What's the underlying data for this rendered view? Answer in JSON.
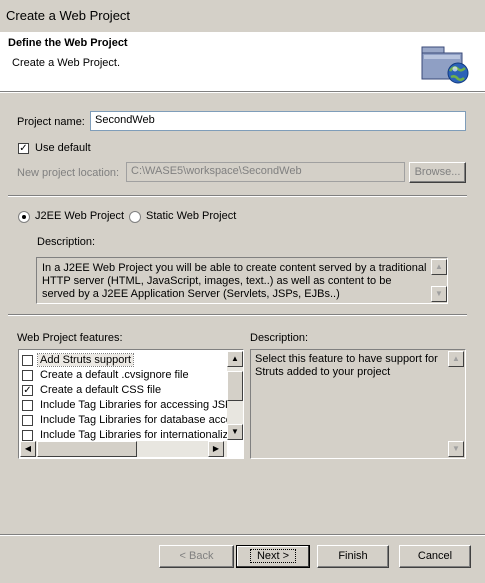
{
  "window": {
    "title": "Create a Web Project"
  },
  "header": {
    "title": "Define the Web Project",
    "subtitle": "Create a Web Project.",
    "icon": "web-project-globe-icon"
  },
  "form": {
    "project_name_label": "Project name:",
    "project_name_value": "SecondWeb",
    "use_default_label": "Use default",
    "use_default_checked": true,
    "location_label": "New project location:",
    "location_value": "C:\\WASE5\\workspace\\SecondWeb",
    "browse_label": "Browse..."
  },
  "project_type": {
    "options": [
      "J2EE Web Project",
      "Static Web Project"
    ],
    "selected": "J2EE Web Project",
    "description_label": "Description:",
    "description_text": "In a J2EE Web Project you will be able to create content served by a traditional HTTP server (HTML, JavaScript, images, text..) as well as content to be served by a J2EE Application Server (Servlets, JSPs, EJBs..)"
  },
  "features": {
    "label": "Web Project features:",
    "items": [
      {
        "label": "Add Struts support",
        "checked": false
      },
      {
        "label": "Create a default .cvsignore file",
        "checked": false
      },
      {
        "label": "Create a default CSS file",
        "checked": true
      },
      {
        "label": "Include Tag Libraries for accessing JSP objects",
        "checked": false
      },
      {
        "label": "Include Tag Libraries for database access",
        "checked": false
      },
      {
        "label": "Include Tag Libraries for internationalization",
        "checked": false
      }
    ],
    "description_label": "Description:",
    "description_text": "Select this feature to have support for Struts added to your project"
  },
  "buttons": {
    "back": "< Back",
    "next": "Next >",
    "finish": "Finish",
    "cancel": "Cancel"
  }
}
